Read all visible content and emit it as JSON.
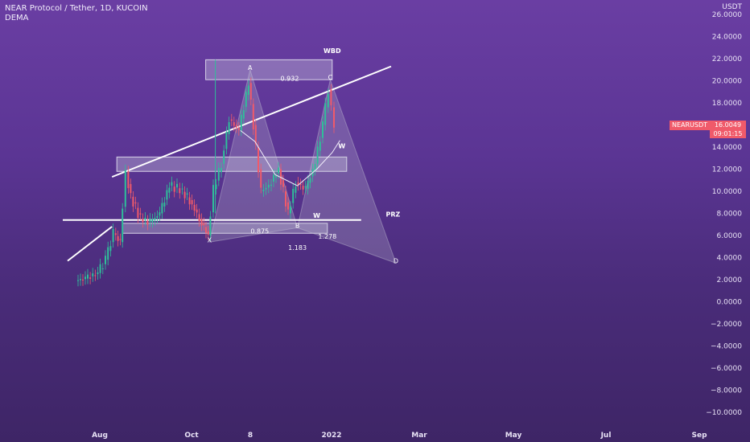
{
  "header": {
    "title": "NEAR Protocol / Tether, 1D, KUCOIN",
    "indicator": "DEMA",
    "currency": "USDT"
  },
  "price_tag": {
    "symbol": "NEARUSDT",
    "price": "16.0049",
    "countdown": "09:01:15",
    "color": "#f05a6a"
  },
  "chart_data": {
    "type": "candlestick",
    "title": "NEAR Protocol / Tether, 1D, KUCOIN",
    "y_range": [
      -10,
      26
    ],
    "y_ticks": [
      "26.0000",
      "24.0000",
      "22.0000",
      "20.0000",
      "18.0000",
      "16.0000",
      "14.0000",
      "12.0000",
      "10.0000",
      "8.0000",
      "6.0000",
      "4.0000",
      "2.0000",
      "0.0000",
      "−2.0000",
      "−4.0000",
      "−6.0000",
      "−8.0000",
      "−10.0000"
    ],
    "x_ticks": [
      "Aug",
      "Oct",
      "8",
      "2022",
      "Mar",
      "May",
      "Jul",
      "Sep"
    ],
    "price_path": [
      {
        "t": "Jul-20",
        "v": 1.9
      },
      {
        "t": "Jul-30",
        "v": 2.1
      },
      {
        "t": "Aug-12",
        "v": 2.6
      },
      {
        "t": "Aug-20",
        "v": 3.8
      },
      {
        "t": "Aug-28",
        "v": 6.2
      },
      {
        "t": "Sep-04",
        "v": 5.4
      },
      {
        "t": "Sep-10",
        "v": 11.8
      },
      {
        "t": "Sep-15",
        "v": 9.5
      },
      {
        "t": "Sep-25",
        "v": 7.5
      },
      {
        "t": "Oct-05",
        "v": 7.2
      },
      {
        "t": "Oct-15",
        "v": 8.0
      },
      {
        "t": "Oct-25",
        "v": 10.5
      },
      {
        "t": "Nov-05",
        "v": 10.2
      },
      {
        "t": "Nov-15",
        "v": 9.2
      },
      {
        "t": "Nov-25",
        "v": 7.5
      },
      {
        "t": "Dec-04",
        "v": 6.0
      },
      {
        "t": "Dec-10",
        "v": 10.2
      },
      {
        "t": "Dec-18",
        "v": 12.5
      },
      {
        "t": "Dec-26",
        "v": 16.5
      },
      {
        "t": "Jan-05",
        "v": 15.5
      },
      {
        "t": "Jan-15",
        "v": 19.8
      },
      {
        "t": "Jan-20",
        "v": 16.0
      },
      {
        "t": "Jan-28",
        "v": 10.0
      },
      {
        "t": "Feb-05",
        "v": 10.5
      },
      {
        "t": "Feb-15",
        "v": 12.0
      },
      {
        "t": "Feb-25",
        "v": 8.0
      },
      {
        "t": "Mar-05",
        "v": 10.8
      },
      {
        "t": "Mar-15",
        "v": 10.2
      },
      {
        "t": "Mar-25",
        "v": 12.5
      },
      {
        "t": "Apr-02",
        "v": 16.0
      },
      {
        "t": "Apr-08",
        "v": 19.2
      },
      {
        "t": "Apr-14",
        "v": 16.0
      }
    ],
    "dema_path": [
      {
        "t": "Jan-05",
        "v": 15.5
      },
      {
        "t": "Jan-20",
        "v": 14.5
      },
      {
        "t": "Feb-10",
        "v": 11.5
      },
      {
        "t": "Mar-05",
        "v": 10.5
      },
      {
        "t": "Mar-25",
        "v": 12.0
      },
      {
        "t": "Apr-10",
        "v": 13.5
      },
      {
        "t": "Apr-18",
        "v": 14.6
      }
    ],
    "annotations": {
      "points": [
        {
          "label": "X",
          "t": "Dec-04",
          "v": 5.4
        },
        {
          "label": "A",
          "t": "Jan-15",
          "v": 21.0
        },
        {
          "label": "B",
          "t": "Mar-05",
          "v": 6.7
        },
        {
          "label": "C",
          "t": "Apr-08",
          "v": 20.1
        },
        {
          "label": "D",
          "t": "Jun-15",
          "v": 3.5
        }
      ],
      "ratios": [
        {
          "label": "0.932",
          "t": "Feb-25",
          "v": 20.0
        },
        {
          "label": "0.875",
          "t": "Jan-25",
          "v": 6.2
        },
        {
          "label": "1.183",
          "t": "Mar-05",
          "v": 4.7
        },
        {
          "label": "1.278",
          "t": "Apr-05",
          "v": 5.7
        }
      ],
      "tags": [
        {
          "label": "WBD",
          "t": "Apr-10",
          "v": 22.5
        },
        {
          "label": "W",
          "t": "Apr-20",
          "v": 13.9
        },
        {
          "label": "W",
          "t": "Mar-25",
          "v": 7.6
        },
        {
          "label": "PRZ",
          "t": "Jun-12",
          "v": 7.7
        }
      ],
      "zones": [
        {
          "t1": "Nov-30",
          "t2": "Apr-10",
          "v1": 20.1,
          "v2": 21.9
        },
        {
          "t1": "Aug-30",
          "t2": "Apr-25",
          "v1": 11.8,
          "v2": 13.1
        },
        {
          "t1": "Sep-05",
          "t2": "Apr-05",
          "v1": 6.2,
          "v2": 7.1
        }
      ],
      "lines": [
        {
          "t1": "Aug-25",
          "v1": 11.3,
          "t2": "Jun-10",
          "v2": 21.3
        },
        {
          "t1": "Aug-25",
          "v1": 6.8,
          "t2": "Jul-10",
          "v2": 3.7
        },
        {
          "t1": "May-10",
          "v1": 7.4,
          "t2": "Jul-05",
          "v2": 7.4
        }
      ]
    }
  }
}
